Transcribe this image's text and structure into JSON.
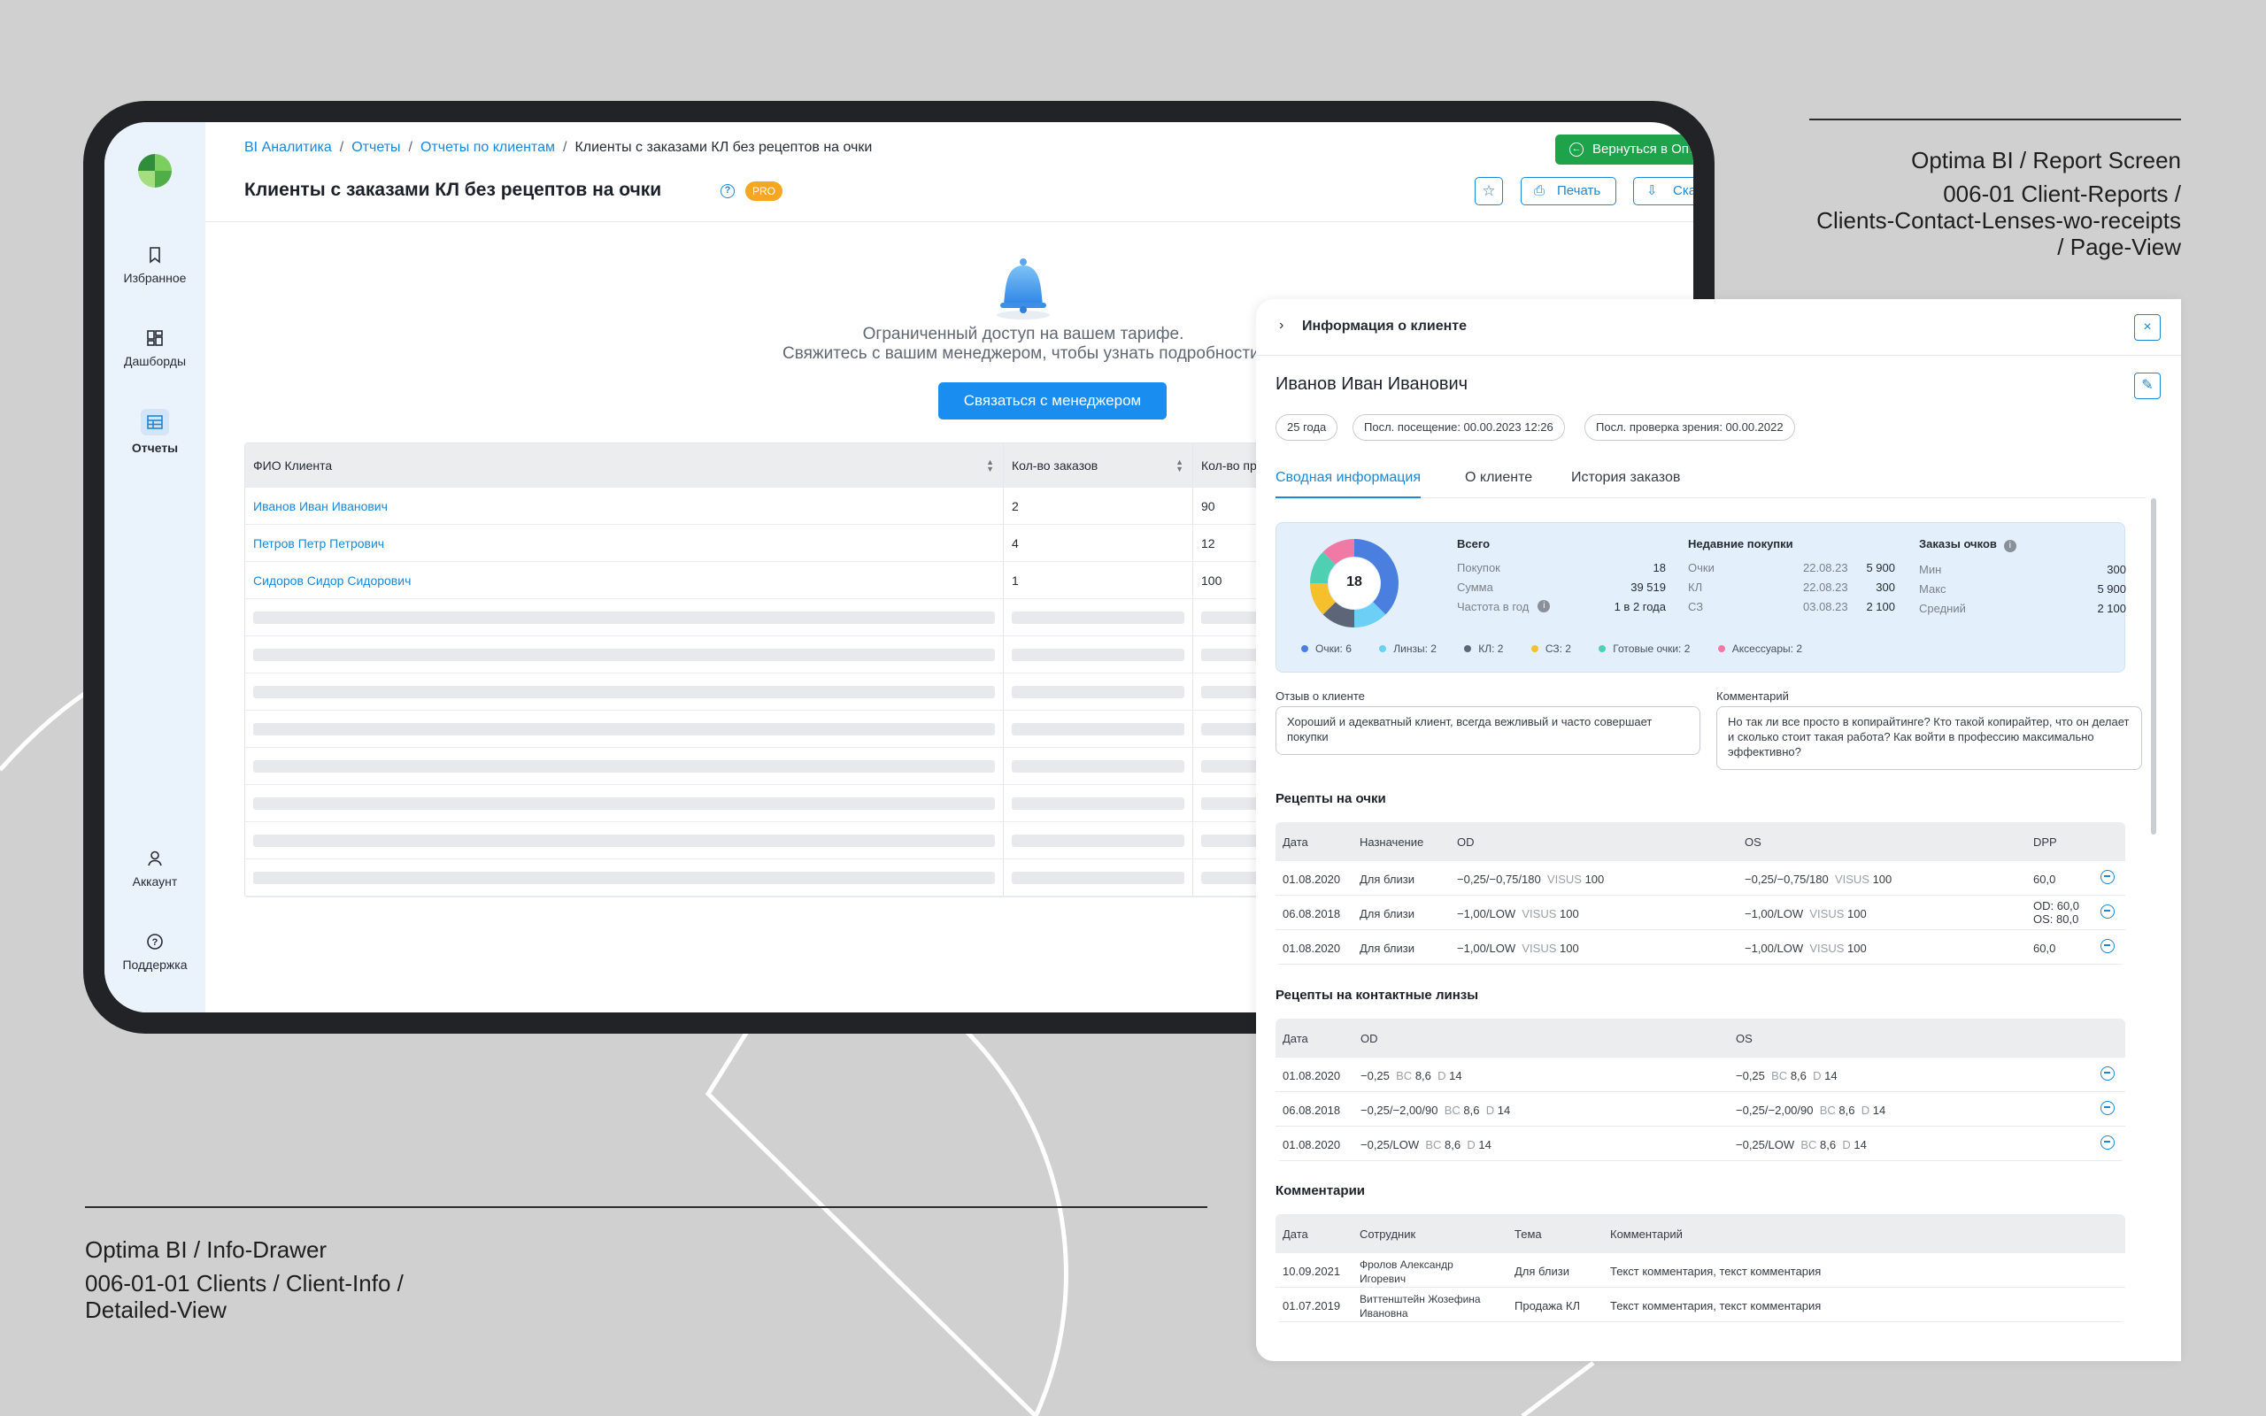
{
  "captions": {
    "right_line1": "Optima BI / Report Screen",
    "right_line2": "006-01 Client-Reports /",
    "right_line3": "Clients-Contact-Lenses-wo-receipts",
    "right_line4": "/ Page-View",
    "left_line1": "Optima BI / Info-Drawer",
    "left_line2": "006-01-01 Clients / Client-Info /",
    "left_line3": "Detailed-View"
  },
  "sidebar": {
    "items": [
      {
        "label": "Избранное",
        "icon": "bookmark-icon"
      },
      {
        "label": "Дашборды",
        "icon": "dashboard-icon"
      },
      {
        "label": "Отчеты",
        "icon": "table-icon"
      },
      {
        "label": "Аккаунт",
        "icon": "user-icon"
      },
      {
        "label": "Поддержка",
        "icon": "help-icon"
      }
    ]
  },
  "breadcrumb": [
    "BI Аналитика",
    "Отчеты",
    "Отчеты по клиентам",
    "Клиенты с заказами КЛ без рецептов на очки"
  ],
  "header": {
    "title": "Клиенты с заказами КЛ без рецептов на очки",
    "badge": "PRO",
    "back_button": "Вернуться в Оптима",
    "print_button": "Печать",
    "download_button": "Скачать"
  },
  "limit": {
    "line1": "Ограниченный доступ на вашем тарифе.",
    "line2": "Свяжитесь с вашим менеджером, чтобы узнать подробности.",
    "button": "Связаться с менеджером"
  },
  "table": {
    "headers": [
      "ФИО Клиента",
      "Кол-во заказов",
      "Кол-во пр"
    ],
    "rows": [
      [
        "Иванов Иван Иванович",
        "2",
        "90"
      ],
      [
        "Петров Петр Петрович",
        "4",
        "12"
      ],
      [
        "Сидоров Сидор Сидорович",
        "1",
        "100"
      ]
    ]
  },
  "drawer": {
    "title": "Информация о клиенте",
    "client_name": "Иванов Иван Иванович",
    "chips": [
      "25 года",
      "Посл. посещение: 00.00.2023 12:26",
      "Посл. проверка зрения: 00.00.2022"
    ],
    "tabs": [
      "Сводная информация",
      "О клиенте",
      "История заказов"
    ],
    "summary": {
      "total_count": "18",
      "total": {
        "title": "Всего",
        "rows": [
          [
            "Покупок",
            "18"
          ],
          [
            "Сумма",
            "39 519"
          ],
          [
            "Частота в год",
            "1 в 2 года"
          ]
        ]
      },
      "recent": {
        "title": "Недавние покупки",
        "rows": [
          [
            "Очки",
            "22.08.23",
            "5 900"
          ],
          [
            "КЛ",
            "22.08.23",
            "300"
          ],
          [
            "СЗ",
            "03.08.23",
            "2 100"
          ]
        ]
      },
      "glasses": {
        "title": "Заказы очков",
        "rows": [
          [
            "Мин",
            "300"
          ],
          [
            "Макс",
            "5 900"
          ],
          [
            "Средний",
            "2 100"
          ]
        ]
      },
      "legend": [
        {
          "label": "Очки: 6",
          "color": "#4a7fe0",
          "value": 6
        },
        {
          "label": "Линзы: 2",
          "color": "#6ccff6",
          "value": 2
        },
        {
          "label": "КЛ: 2",
          "color": "#5d6678",
          "value": 2
        },
        {
          "label": "СЗ: 2",
          "color": "#f5c02b",
          "value": 2
        },
        {
          "label": "Готовые очки: 2",
          "color": "#4fd0b2",
          "value": 2
        },
        {
          "label": "Аксессуары: 2",
          "color": "#f07aa5",
          "value": 2
        }
      ]
    },
    "feedback_label": "Отзыв о клиенте",
    "feedback_text": "Хороший и адекватный клиент, всегда вежливый и часто совершает покупки",
    "comment_label": "Комментарий",
    "comment_text": "Но так ли все просто в копирайтинге? Кто такой копирайтер, что он делает и сколько стоит такая работа? Как войти в профессию максимально эффективно?",
    "glasses_rx": {
      "title": "Рецепты на очки",
      "headers": [
        "Дата",
        "Назначение",
        "OD",
        "OS",
        "DPP"
      ],
      "rows": [
        {
          "date": "01.08.2020",
          "purpose": "Для близи",
          "od": "−0,25/−0,75/180",
          "od_vis": "VISUS",
          "od_val": "100",
          "os": "−0,25/−0,75/180",
          "os_vis": "VISUS",
          "os_val": "100",
          "dpp": "60,0",
          "dpp2": ""
        },
        {
          "date": "06.08.2018",
          "purpose": "Для близи",
          "od": "−1,00/LOW",
          "od_vis": "VISUS",
          "od_val": "100",
          "os": "−1,00/LOW",
          "os_vis": "VISUS",
          "os_val": "100",
          "dpp": "OD: 60,0",
          "dpp2": "OS: 80,0"
        },
        {
          "date": "01.08.2020",
          "purpose": "Для близи",
          "od": "−1,00/LOW",
          "od_vis": "VISUS",
          "od_val": "100",
          "os": "−1,00/LOW",
          "os_vis": "VISUS",
          "os_val": "100",
          "dpp": "60,0",
          "dpp2": ""
        }
      ]
    },
    "lens_rx": {
      "title": "Рецепты на контактные линзы",
      "headers": [
        "Дата",
        "OD",
        "OS"
      ],
      "rows": [
        {
          "date": "01.08.2020",
          "od": "−0,25",
          "os": "−0,25"
        },
        {
          "date": "06.08.2018",
          "od": "−0,25/−2,00/90",
          "os": "−0,25/−2,00/90"
        },
        {
          "date": "01.08.2020",
          "od": "−0,25/LOW",
          "os": "−0,25/LOW"
        }
      ],
      "bc_label": "BC",
      "bc_value": "8,6",
      "d_label": "D",
      "d_value": "14"
    },
    "comments": {
      "title": "Комментарии",
      "headers": [
        "Дата",
        "Сотрудник",
        "Тема",
        "Комментарий"
      ],
      "rows": [
        {
          "date": "10.09.2021",
          "emp1": "Фролов Александр",
          "emp2": "Игоревич",
          "topic": "Для близи",
          "text": "Текст комментария, текст комментария"
        },
        {
          "date": "01.07.2019",
          "emp1": "Виттенштейн Жозефина",
          "emp2": "Ивановна",
          "topic": "Продажа КЛ",
          "text": "Текст комментария, текст комментария"
        }
      ]
    }
  }
}
